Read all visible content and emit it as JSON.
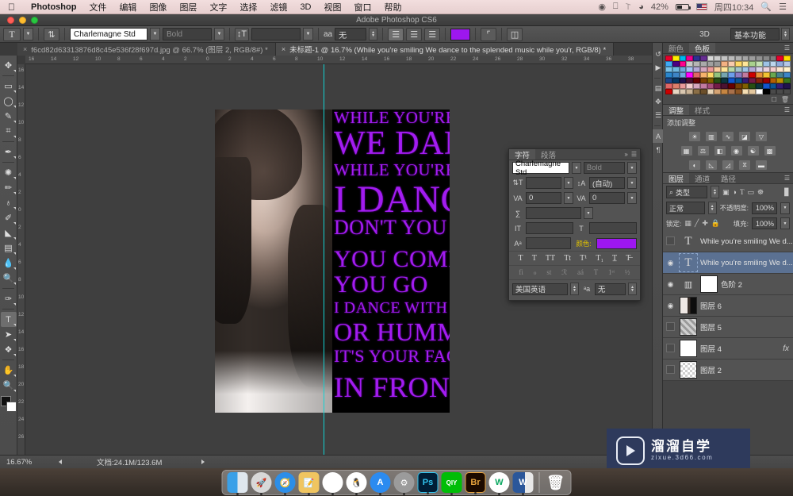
{
  "mac_menubar": {
    "apple_icon": "apple-icon",
    "app_name": "Photoshop",
    "menus": [
      "文件",
      "编辑",
      "图像",
      "图层",
      "文字",
      "选择",
      "滤镜",
      "3D",
      "视图",
      "窗口",
      "帮助"
    ],
    "status": {
      "airplay_icon": "airplay-icon",
      "bluetooth_icon": "bluetooth-icon",
      "wifi_icon": "wifi-icon",
      "battery_percent": "42%",
      "input_flag": "us-flag-icon",
      "clock": "周四10:34",
      "spotlight_icon": "search-icon",
      "notification_icon": "list-icon"
    }
  },
  "titlebar": {
    "title": "Adobe Photoshop CS6"
  },
  "options_bar": {
    "tool_icon": "type-tool-icon",
    "orientation_icon": "text-orientation-icon",
    "font_family": "Charlemagne Std",
    "font_style": "Bold",
    "font_size": "",
    "antialias_label": "aa",
    "antialias_value": "无",
    "align_icons": [
      "align-left-icon",
      "align-center-icon",
      "align-right-icon"
    ],
    "text_color": "#9d17ef",
    "warp_icon": "warp-text-icon",
    "panels_icon": "toggle-panels-icon",
    "3d_label": "3D",
    "workspace": "基本功能"
  },
  "document_tabs": [
    {
      "title": "f6cd82d63313876d8c45e536f28f697d.jpg @ 66.7% (图层 2, RGB/8#) *",
      "active": false
    },
    {
      "title": "未标题-1 @ 16.7% (While you're smiling We dance to the splended music while you'r, RGB/8) *",
      "active": true
    }
  ],
  "rulers": {
    "horizontal": [
      "16",
      "14",
      "12",
      "10",
      "8",
      "6",
      "4",
      "2",
      "0",
      "2",
      "4",
      "6",
      "8",
      "10",
      "12",
      "14",
      "16",
      "18",
      "20",
      "22",
      "24",
      "26",
      "28",
      "30",
      "32",
      "34",
      "36",
      "38"
    ],
    "vertical": [
      "16",
      "14",
      "12",
      "10",
      "8",
      "6",
      "4",
      "2",
      "0",
      "2",
      "4",
      "6",
      "8",
      "10",
      "12",
      "14",
      "16",
      "18",
      "20",
      "22",
      "24",
      "26"
    ]
  },
  "toolbar": {
    "tools": [
      {
        "name": "move-tool",
        "glyph": "✥"
      },
      {
        "name": "marquee-tool",
        "glyph": "▭"
      },
      {
        "name": "lasso-tool",
        "glyph": "◯"
      },
      {
        "name": "quick-selection-tool",
        "glyph": "✎"
      },
      {
        "name": "crop-tool",
        "glyph": "⌗"
      },
      {
        "name": "eyedropper-tool",
        "glyph": "✒"
      },
      {
        "name": "spot-healing-tool",
        "glyph": "✺"
      },
      {
        "name": "brush-tool",
        "glyph": "✏"
      },
      {
        "name": "clone-stamp-tool",
        "glyph": "♁"
      },
      {
        "name": "history-brush-tool",
        "glyph": "✐"
      },
      {
        "name": "eraser-tool",
        "glyph": "◣"
      },
      {
        "name": "gradient-tool",
        "glyph": "▤"
      },
      {
        "name": "blur-tool",
        "glyph": "💧"
      },
      {
        "name": "dodge-tool",
        "glyph": "🔍"
      },
      {
        "name": "pen-tool",
        "glyph": "✑"
      },
      {
        "name": "type-tool",
        "glyph": "T",
        "selected": true
      },
      {
        "name": "path-selection-tool",
        "glyph": "➤"
      },
      {
        "name": "shape-tool",
        "glyph": "❖"
      },
      {
        "name": "hand-tool",
        "glyph": "✋"
      },
      {
        "name": "zoom-tool",
        "glyph": "🔍"
      }
    ],
    "foreground_color": "#111111",
    "background_color": "#ffffff"
  },
  "canvas": {
    "artboard_background": "#000000",
    "text_color": "#a21cf0",
    "guide_color": "#13d2d2",
    "poster_lines": [
      "WHILE YOU'RE SMILING",
      "WE DANCE",
      "WHILE YOU'RE",
      "I DANCE",
      "DON'T YOU KNOW",
      "YOU COME",
      "YOU GO",
      "I DANCE WITH YOU",
      "OR HUMMING",
      "IT'S YOUR FACE",
      "IN FRONT"
    ]
  },
  "character_panel": {
    "tabs": [
      "字符",
      "段落"
    ],
    "active_tab": "字符",
    "font_family": "Charlemagne Std",
    "font_style": "Bold",
    "font_size": "",
    "leading": "(自动)",
    "kerning": "0",
    "tracking": "0",
    "vertical_scale": "",
    "horizontal_scale": "",
    "baseline_shift": "",
    "color_label": "颜色:",
    "color_value": "#9d17ef",
    "faux_row": [
      "T",
      "T",
      "TT",
      "Tt",
      "T¹",
      "T₁",
      "T̲",
      "T̶"
    ],
    "opentype_row": [
      "fi",
      "ℴ",
      "st",
      "ℛ",
      "aá",
      "T",
      "1ˢᵗ",
      "½"
    ],
    "language": "美国英语",
    "antialias_icon": "aa-icon",
    "antialias_value": "无"
  },
  "dock_strip": {
    "items": [
      {
        "name": "history-icon",
        "glyph": "↺"
      },
      {
        "name": "actions-icon",
        "glyph": "▶"
      },
      {
        "name": "properties-icon",
        "glyph": "▤"
      },
      {
        "name": "brush-presets-icon",
        "glyph": "✥"
      },
      {
        "name": "brush-settings-icon",
        "glyph": "☰"
      },
      {
        "name": "character-panel-icon",
        "glyph": "A",
        "selected": true
      },
      {
        "name": "paragraph-panel-icon",
        "glyph": "¶"
      }
    ]
  },
  "color_panel": {
    "tabs": [
      "颜色",
      "色板"
    ],
    "active_tab": "色板",
    "swatch_colors": [
      "#e8002b",
      "#ffee00",
      "#00b7ef",
      "#ec008c",
      "#2e3192",
      "#662d91",
      "#d7d7d7",
      "#cccccc",
      "#c4c4c4",
      "#bbbbbb",
      "#b0b0b0",
      "#a6a6a6",
      "#9c9c9c",
      "#929292",
      "#888888",
      "#7d7d7d",
      "#e8002b",
      "#ffdd00",
      "#3fa9f5",
      "#4b0082",
      "#ff0090",
      "#c9c9c9",
      "#b5b5b5",
      "#aaaaaa",
      "#a0a0a0",
      "#989898",
      "#f4b183",
      "#f8cbad",
      "#ffd966",
      "#ffe699",
      "#a9d18e",
      "#c5e0b4",
      "#9dc3e6",
      "#bdd7ee",
      "#8faadc",
      "#b4c7e7",
      "#79c1e8",
      "#6fb7e0",
      "#6fa8dc",
      "#a4c2f4",
      "#b4a7d6",
      "#d5a6bd",
      "#ea9999",
      "#f9cb9d",
      "#ffe599",
      "#b6d7a8",
      "#a2c4c9",
      "#9fc5e8",
      "#b4a7d6",
      "#d9d2e9",
      "#ead1dc",
      "#f4cccc",
      "#fce5cd",
      "#fff2cc",
      "#2986cc",
      "#3d85c6",
      "#6fa8dc",
      "#ff00ff",
      "#e06666",
      "#f6b26b",
      "#ffd966",
      "#93c47d",
      "#76a5af",
      "#6d9eeb",
      "#8e7cc3",
      "#c27ba0",
      "#cc0000",
      "#e69138",
      "#f1c232",
      "#6aa84f",
      "#45818e",
      "#3d85c6",
      "#1c4587",
      "#073763",
      "#20124d",
      "#4c1130",
      "#660000",
      "#783f04",
      "#7f6000",
      "#274e13",
      "#0c343d",
      "#1155cc",
      "#0b5394",
      "#351c75",
      "#741b47",
      "#85200c",
      "#990000",
      "#b45f06",
      "#bf9000",
      "#38761d",
      "#e06666",
      "#dd7e6b",
      "#ea9999",
      "#f4cccc",
      "#d5a6bd",
      "#c27ba0",
      "#a64d79",
      "#741b47",
      "#4c1130",
      "#660000",
      "#783f04",
      "#7f6000",
      "#274e13",
      "#0c343d",
      "#1155cc",
      "#0b5394",
      "#351c75",
      "#20124d",
      "#cc0000",
      "#e6d7c3",
      "#d9c7b0",
      "#c9b396",
      "#8b6f47",
      "#6b4f2a",
      "#e8d5b7",
      "#d4a373",
      "#c68642",
      "#a9714b",
      "#8d5524",
      "#f5deb3",
      "#e3c79e",
      "#ffffff",
      "#000000",
      "#4a4a4a",
      "#4a4a4a",
      "#4a4a4a"
    ]
  },
  "adjustments_panel": {
    "tabs": [
      "调整",
      "样式"
    ],
    "active_tab": "调整",
    "label": "添加调整",
    "row1": [
      {
        "name": "brightness-contrast-icon",
        "glyph": "☀"
      },
      {
        "name": "levels-icon",
        "glyph": "▥"
      },
      {
        "name": "curves-icon",
        "glyph": "∿"
      },
      {
        "name": "exposure-icon",
        "glyph": "◪"
      },
      {
        "name": "vibrance-icon",
        "glyph": "▽"
      }
    ],
    "row2": [
      {
        "name": "hue-saturation-icon",
        "glyph": "▦"
      },
      {
        "name": "color-balance-icon",
        "glyph": "⚖"
      },
      {
        "name": "black-white-icon",
        "glyph": "◧"
      },
      {
        "name": "photo-filter-icon",
        "glyph": "◉"
      },
      {
        "name": "channel-mixer-icon",
        "glyph": "☯"
      },
      {
        "name": "color-lookup-icon",
        "glyph": "▩"
      }
    ],
    "row3": [
      {
        "name": "invert-icon",
        "glyph": "◐"
      },
      {
        "name": "posterize-icon",
        "glyph": "◺"
      },
      {
        "name": "threshold-icon",
        "glyph": "◿"
      },
      {
        "name": "selective-color-icon",
        "glyph": "⧖"
      },
      {
        "name": "gradient-map-icon",
        "glyph": "▬"
      }
    ]
  },
  "layers_panel": {
    "tabs": [
      "图层",
      "通道",
      "路径"
    ],
    "active_tab": "图层",
    "filter_label": "类型",
    "filter_icons": [
      "pixel-filter-icon",
      "adjustment-filter-icon",
      "type-filter-icon",
      "shape-filter-icon",
      "smartobject-filter-icon"
    ],
    "blend_mode": "正常",
    "opacity_label": "不透明度:",
    "opacity_value": "100%",
    "lock_label": "锁定:",
    "lock_icons": [
      "lock-transparent-icon",
      "lock-image-icon",
      "lock-position-icon",
      "lock-all-icon"
    ],
    "fill_label": "填充:",
    "fill_value": "100%",
    "layers": [
      {
        "name": "While you're smiling We d...",
        "type": "text",
        "visible": false,
        "active": false
      },
      {
        "name": "While you're smiling We d...",
        "type": "text",
        "visible": true,
        "active": true
      },
      {
        "name": "色阶 2",
        "type": "adjustment",
        "visible": true,
        "active": false
      },
      {
        "name": "图层 6",
        "type": "image",
        "visible": true,
        "active": false
      },
      {
        "name": "图层 5",
        "type": "image",
        "visible": false,
        "active": false
      },
      {
        "name": "图层 4",
        "type": "image",
        "visible": false,
        "active": false,
        "fx": "fx"
      },
      {
        "name": "图层 2",
        "type": "image",
        "visible": false,
        "active": false
      }
    ]
  },
  "status_bar": {
    "zoom": "16.67%",
    "doc_info": "文档:24.1M/123.6M"
  },
  "dock": {
    "apps": [
      {
        "name": "finder",
        "label": "",
        "color": "#3aa0e8"
      },
      {
        "name": "launchpad",
        "label": "🚀",
        "color": "#d8d8d8"
      },
      {
        "name": "safari",
        "label": "🧭",
        "color": "#2c8ee8"
      },
      {
        "name": "notes",
        "label": "📝",
        "color": "#f0c560"
      },
      {
        "name": "photos",
        "label": "❀",
        "color": "#ffffff"
      },
      {
        "name": "qq",
        "label": "🐧",
        "color": "#ffffff"
      },
      {
        "name": "app-store",
        "label": "A",
        "color": "#2b8bf0"
      },
      {
        "name": "system-preferences",
        "label": "⚙",
        "color": "#9b9b9b"
      },
      {
        "name": "photoshop",
        "label": "Ps",
        "color": "#001e36"
      },
      {
        "name": "iqiyi",
        "label": "QIY",
        "color": "#00be06"
      },
      {
        "name": "bridge",
        "label": "Br",
        "color": "#1c0a00"
      },
      {
        "name": "wechat-work",
        "label": "W",
        "color": "#ffffff"
      },
      {
        "name": "word",
        "label": "W",
        "color": "#2b579a"
      }
    ],
    "trash": "trash-icon"
  },
  "watermark": {
    "brand": "溜溜自学",
    "url": "zixue.3d66.com",
    "logo_icon": "play-logo-icon",
    "background": "#2e3a5c"
  }
}
